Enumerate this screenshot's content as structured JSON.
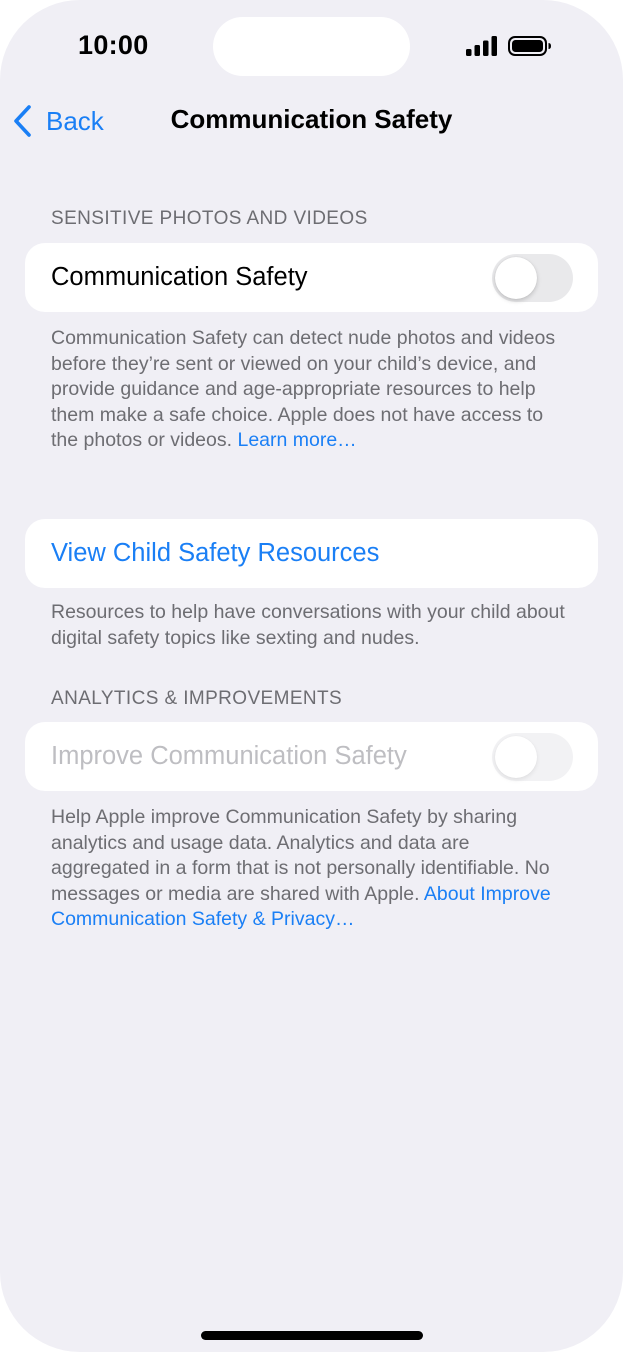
{
  "status_bar": {
    "time": "10:00",
    "signal_icon": "cellular-signal-icon",
    "battery_icon": "battery-icon"
  },
  "nav": {
    "back_label": "Back",
    "back_icon": "chevron-left-icon",
    "title": "Communication Safety"
  },
  "sensitive_section": {
    "header": "SENSITIVE PHOTOS AND VIDEOS",
    "toggle_label": "Communication Safety",
    "toggle_on": false,
    "footer_text": "Communication Safety can detect nude photos and videos before they’re sent or viewed on your child’s device, and provide guidance and age-appropriate resources to help them make a safe choice. Apple does not have access to the photos or videos.",
    "footer_link": "Learn more…"
  },
  "resources_section": {
    "link_label": "View Child Safety Resources",
    "footer_text": "Resources to help have conversations with your child about digital safety topics like sexting and nudes."
  },
  "analytics_section": {
    "header": "ANALYTICS & IMPROVEMENTS",
    "toggle_label": "Improve Communication Safety",
    "toggle_on": false,
    "toggle_enabled": false,
    "footer_text": "Help Apple improve Communication Safety by sharing analytics and usage data. Analytics and data are aggregated in a form that is not personally identifiable. No messages or media are shared with Apple.",
    "footer_link": "About Improve Communication Safety & Privacy…"
  },
  "colors": {
    "background": "#f0eff5",
    "accent": "#1a7ff5",
    "secondary_text": "#6d6d72",
    "disabled_text": "#bebec2"
  }
}
